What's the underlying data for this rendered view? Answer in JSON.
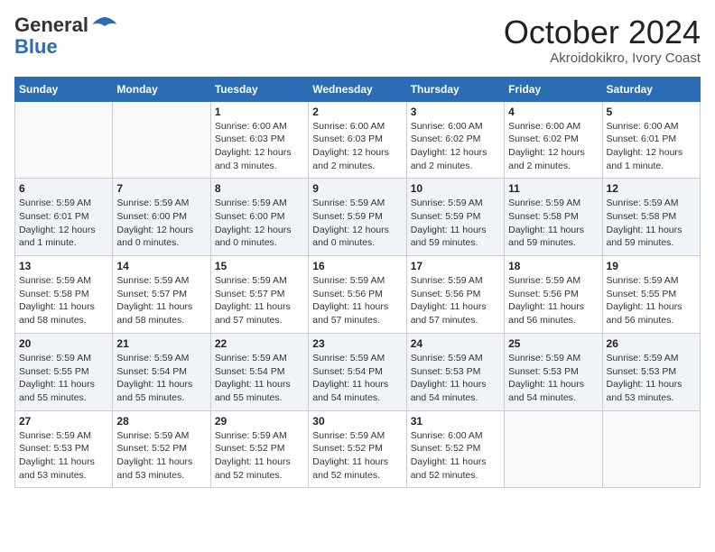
{
  "header": {
    "logo_general": "General",
    "logo_blue": "Blue",
    "month_title": "October 2024",
    "subtitle": "Akroidokikro, Ivory Coast"
  },
  "calendar": {
    "headers": [
      "Sunday",
      "Monday",
      "Tuesday",
      "Wednesday",
      "Thursday",
      "Friday",
      "Saturday"
    ],
    "weeks": [
      [
        {
          "day": "",
          "info": ""
        },
        {
          "day": "",
          "info": ""
        },
        {
          "day": "1",
          "info": "Sunrise: 6:00 AM\nSunset: 6:03 PM\nDaylight: 12 hours\nand 3 minutes."
        },
        {
          "day": "2",
          "info": "Sunrise: 6:00 AM\nSunset: 6:03 PM\nDaylight: 12 hours\nand 2 minutes."
        },
        {
          "day": "3",
          "info": "Sunrise: 6:00 AM\nSunset: 6:02 PM\nDaylight: 12 hours\nand 2 minutes."
        },
        {
          "day": "4",
          "info": "Sunrise: 6:00 AM\nSunset: 6:02 PM\nDaylight: 12 hours\nand 2 minutes."
        },
        {
          "day": "5",
          "info": "Sunrise: 6:00 AM\nSunset: 6:01 PM\nDaylight: 12 hours\nand 1 minute."
        }
      ],
      [
        {
          "day": "6",
          "info": "Sunrise: 5:59 AM\nSunset: 6:01 PM\nDaylight: 12 hours\nand 1 minute."
        },
        {
          "day": "7",
          "info": "Sunrise: 5:59 AM\nSunset: 6:00 PM\nDaylight: 12 hours\nand 0 minutes."
        },
        {
          "day": "8",
          "info": "Sunrise: 5:59 AM\nSunset: 6:00 PM\nDaylight: 12 hours\nand 0 minutes."
        },
        {
          "day": "9",
          "info": "Sunrise: 5:59 AM\nSunset: 5:59 PM\nDaylight: 12 hours\nand 0 minutes."
        },
        {
          "day": "10",
          "info": "Sunrise: 5:59 AM\nSunset: 5:59 PM\nDaylight: 11 hours\nand 59 minutes."
        },
        {
          "day": "11",
          "info": "Sunrise: 5:59 AM\nSunset: 5:58 PM\nDaylight: 11 hours\nand 59 minutes."
        },
        {
          "day": "12",
          "info": "Sunrise: 5:59 AM\nSunset: 5:58 PM\nDaylight: 11 hours\nand 59 minutes."
        }
      ],
      [
        {
          "day": "13",
          "info": "Sunrise: 5:59 AM\nSunset: 5:58 PM\nDaylight: 11 hours\nand 58 minutes."
        },
        {
          "day": "14",
          "info": "Sunrise: 5:59 AM\nSunset: 5:57 PM\nDaylight: 11 hours\nand 58 minutes."
        },
        {
          "day": "15",
          "info": "Sunrise: 5:59 AM\nSunset: 5:57 PM\nDaylight: 11 hours\nand 57 minutes."
        },
        {
          "day": "16",
          "info": "Sunrise: 5:59 AM\nSunset: 5:56 PM\nDaylight: 11 hours\nand 57 minutes."
        },
        {
          "day": "17",
          "info": "Sunrise: 5:59 AM\nSunset: 5:56 PM\nDaylight: 11 hours\nand 57 minutes."
        },
        {
          "day": "18",
          "info": "Sunrise: 5:59 AM\nSunset: 5:56 PM\nDaylight: 11 hours\nand 56 minutes."
        },
        {
          "day": "19",
          "info": "Sunrise: 5:59 AM\nSunset: 5:55 PM\nDaylight: 11 hours\nand 56 minutes."
        }
      ],
      [
        {
          "day": "20",
          "info": "Sunrise: 5:59 AM\nSunset: 5:55 PM\nDaylight: 11 hours\nand 55 minutes."
        },
        {
          "day": "21",
          "info": "Sunrise: 5:59 AM\nSunset: 5:54 PM\nDaylight: 11 hours\nand 55 minutes."
        },
        {
          "day": "22",
          "info": "Sunrise: 5:59 AM\nSunset: 5:54 PM\nDaylight: 11 hours\nand 55 minutes."
        },
        {
          "day": "23",
          "info": "Sunrise: 5:59 AM\nSunset: 5:54 PM\nDaylight: 11 hours\nand 54 minutes."
        },
        {
          "day": "24",
          "info": "Sunrise: 5:59 AM\nSunset: 5:53 PM\nDaylight: 11 hours\nand 54 minutes."
        },
        {
          "day": "25",
          "info": "Sunrise: 5:59 AM\nSunset: 5:53 PM\nDaylight: 11 hours\nand 54 minutes."
        },
        {
          "day": "26",
          "info": "Sunrise: 5:59 AM\nSunset: 5:53 PM\nDaylight: 11 hours\nand 53 minutes."
        }
      ],
      [
        {
          "day": "27",
          "info": "Sunrise: 5:59 AM\nSunset: 5:53 PM\nDaylight: 11 hours\nand 53 minutes."
        },
        {
          "day": "28",
          "info": "Sunrise: 5:59 AM\nSunset: 5:52 PM\nDaylight: 11 hours\nand 53 minutes."
        },
        {
          "day": "29",
          "info": "Sunrise: 5:59 AM\nSunset: 5:52 PM\nDaylight: 11 hours\nand 52 minutes."
        },
        {
          "day": "30",
          "info": "Sunrise: 5:59 AM\nSunset: 5:52 PM\nDaylight: 11 hours\nand 52 minutes."
        },
        {
          "day": "31",
          "info": "Sunrise: 6:00 AM\nSunset: 5:52 PM\nDaylight: 11 hours\nand 52 minutes."
        },
        {
          "day": "",
          "info": ""
        },
        {
          "day": "",
          "info": ""
        }
      ]
    ]
  }
}
